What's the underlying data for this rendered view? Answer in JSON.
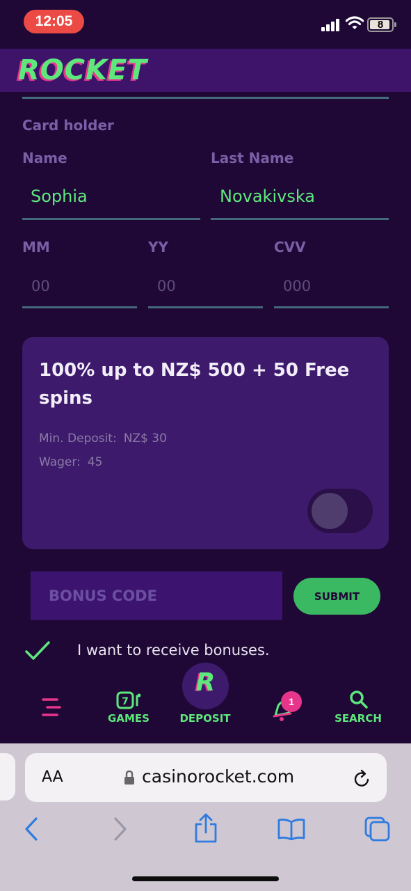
{
  "status_bar": {
    "time": "12:05",
    "battery": "8"
  },
  "header": {
    "logo": "ROCKET"
  },
  "form": {
    "card_holder_label": "Card holder",
    "name_label": "Name",
    "name_value": "Sophia",
    "last_name_label": "Last Name",
    "last_name_value": "Novakivska",
    "mm_label": "MM",
    "mm_placeholder": "00",
    "yy_label": "YY",
    "yy_placeholder": "00",
    "cvv_label": "CVV",
    "cvv_placeholder": "000"
  },
  "bonus_card": {
    "title": "100% up to NZ$ 500 + 50 Free spins",
    "min_deposit_label": "Min. Deposit:",
    "min_deposit_value": "NZ$ 30",
    "wager_label": "Wager:",
    "wager_value": "45",
    "toggle_on": false
  },
  "bonus_code": {
    "placeholder": "BONUS CODE",
    "submit_label": "SUBMIT"
  },
  "consent": {
    "text": "I want to receive bonuses.",
    "checked": true
  },
  "bottom_nav": {
    "games_label": "GAMES",
    "games_icon_number": "7",
    "deposit_label": "DEPOSIT",
    "deposit_icon_letter": "R",
    "notifications_badge": "1",
    "search_label": "SEARCH"
  },
  "browser": {
    "aa": "AA",
    "url": "casinorocket.com"
  },
  "colors": {
    "accent_green": "#5ee87c",
    "accent_pink": "#e8358c",
    "background": "#1f0836"
  }
}
